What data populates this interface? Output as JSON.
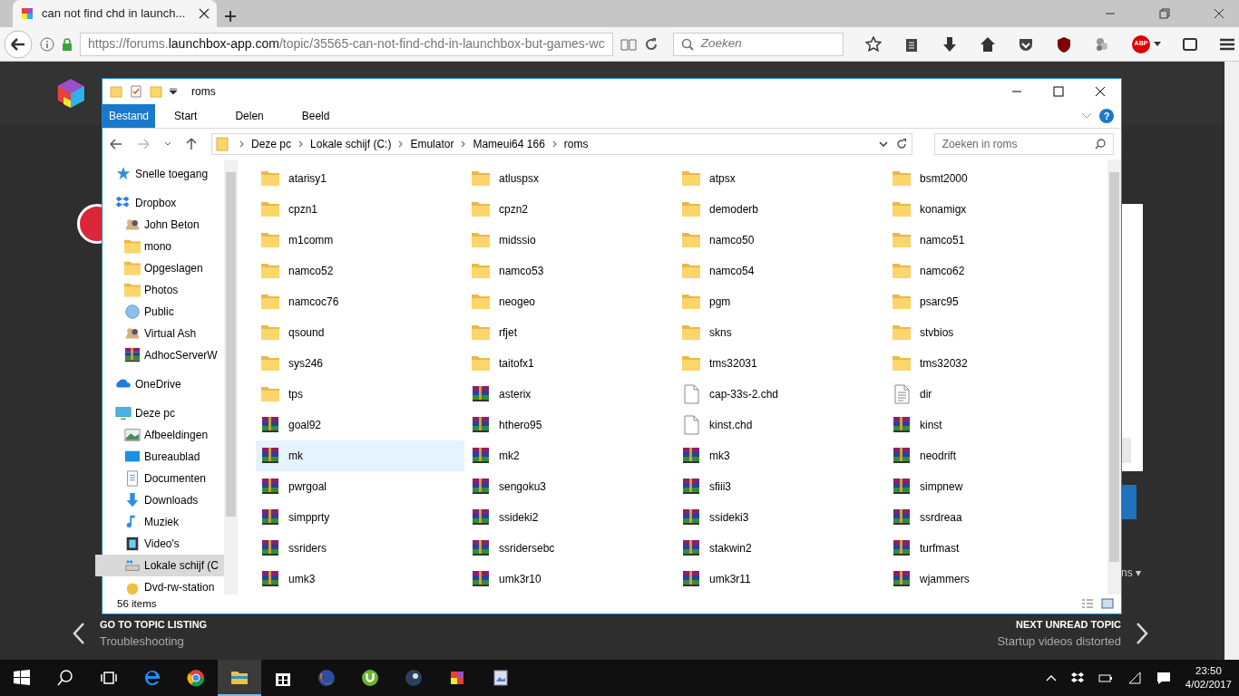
{
  "browser": {
    "tab_title": "can not find chd in launch...",
    "url_scheme": "https://forums.",
    "url_domain": "launchbox-app.com",
    "url_path": "/topic/35565-can-not-find-chd-in-launchbox-but-games-wc",
    "search_placeholder": "Zoeken",
    "abp": "ABP"
  },
  "page": {
    "prev_label": "GO TO TOPIC LISTING",
    "prev_title": "Troubleshooting",
    "next_label": "NEXT UNREAD TOPIC",
    "next_title": "Startup videos distorted",
    "side_fragment": "ns ▾"
  },
  "explorer": {
    "title": "roms",
    "ribbon_tabs": [
      {
        "label": "Bestand",
        "kind": "file"
      },
      {
        "label": "Start",
        "kind": "tab"
      },
      {
        "label": "Delen",
        "kind": "tab"
      },
      {
        "label": "Beeld",
        "kind": "tab"
      }
    ],
    "breadcrumb": [
      "Deze pc",
      "Lokale schijf (C:)",
      "Emulator",
      "Mameui64 166",
      "roms"
    ],
    "search_placeholder": "Zoeken in roms",
    "help": "?",
    "sidebar": [
      {
        "label": "Snelle toegang",
        "selected": false
      },
      {
        "label": "Dropbox",
        "selected": false,
        "children": [
          {
            "label": "John Beton",
            "selected": false
          },
          {
            "label": "mono",
            "selected": false
          },
          {
            "label": "Opgeslagen",
            "selected": false
          },
          {
            "label": "Photos",
            "selected": false
          },
          {
            "label": "Public",
            "selected": false
          },
          {
            "label": "Virtual Ash",
            "selected": false
          },
          {
            "label": "AdhocServerW",
            "selected": false
          }
        ]
      },
      {
        "label": "OneDrive",
        "selected": false
      },
      {
        "label": "Deze pc",
        "selected": false,
        "children": [
          {
            "label": "Afbeeldingen",
            "selected": false
          },
          {
            "label": "Bureaublad",
            "selected": false
          },
          {
            "label": "Documenten",
            "selected": false
          },
          {
            "label": "Downloads",
            "selected": false
          },
          {
            "label": "Muziek",
            "selected": false
          },
          {
            "label": "Video's",
            "selected": false
          },
          {
            "label": "Lokale schijf (C",
            "selected": true
          },
          {
            "label": "Dvd-rw-station",
            "selected": false
          }
        ]
      }
    ],
    "files": [
      {
        "name": "atarisy1",
        "kind": "folder",
        "selected": false
      },
      {
        "name": "atluspsx",
        "kind": "folder",
        "selected": false
      },
      {
        "name": "atpsx",
        "kind": "folder",
        "selected": false
      },
      {
        "name": "bsmt2000",
        "kind": "folder",
        "selected": false
      },
      {
        "name": "cpzn1",
        "kind": "folder",
        "selected": false
      },
      {
        "name": "cpzn2",
        "kind": "folder",
        "selected": false
      },
      {
        "name": "demoderb",
        "kind": "folder",
        "selected": false
      },
      {
        "name": "konamigx",
        "kind": "folder",
        "selected": false
      },
      {
        "name": "m1comm",
        "kind": "folder",
        "selected": false
      },
      {
        "name": "midssio",
        "kind": "folder",
        "selected": false
      },
      {
        "name": "namco50",
        "kind": "folder",
        "selected": false
      },
      {
        "name": "namco51",
        "kind": "folder",
        "selected": false
      },
      {
        "name": "namco52",
        "kind": "folder",
        "selected": false
      },
      {
        "name": "namco53",
        "kind": "folder",
        "selected": false
      },
      {
        "name": "namco54",
        "kind": "folder",
        "selected": false
      },
      {
        "name": "namco62",
        "kind": "folder",
        "selected": false
      },
      {
        "name": "namcoc76",
        "kind": "folder",
        "selected": false
      },
      {
        "name": "neogeo",
        "kind": "folder",
        "selected": false
      },
      {
        "name": "pgm",
        "kind": "folder",
        "selected": false
      },
      {
        "name": "psarc95",
        "kind": "folder",
        "selected": false
      },
      {
        "name": "qsound",
        "kind": "folder",
        "selected": false
      },
      {
        "name": "rfjet",
        "kind": "folder",
        "selected": false
      },
      {
        "name": "skns",
        "kind": "folder",
        "selected": false
      },
      {
        "name": "stvbios",
        "kind": "folder",
        "selected": false
      },
      {
        "name": "sys246",
        "kind": "folder",
        "selected": false
      },
      {
        "name": "taitofx1",
        "kind": "folder",
        "selected": false
      },
      {
        "name": "tms32031",
        "kind": "folder",
        "selected": false
      },
      {
        "name": "tms32032",
        "kind": "folder",
        "selected": false
      },
      {
        "name": "tps",
        "kind": "folder",
        "selected": false
      },
      {
        "name": "asterix",
        "kind": "archive",
        "selected": false
      },
      {
        "name": "cap-33s-2.chd",
        "kind": "file",
        "selected": false
      },
      {
        "name": "dir",
        "kind": "text",
        "selected": false
      },
      {
        "name": "goal92",
        "kind": "archive",
        "selected": false
      },
      {
        "name": "hthero95",
        "kind": "archive",
        "selected": false
      },
      {
        "name": "kinst.chd",
        "kind": "file",
        "selected": false
      },
      {
        "name": "kinst",
        "kind": "archive",
        "selected": false
      },
      {
        "name": "mk",
        "kind": "archive",
        "selected": true
      },
      {
        "name": "mk2",
        "kind": "archive",
        "selected": false
      },
      {
        "name": "mk3",
        "kind": "archive",
        "selected": false
      },
      {
        "name": "neodrift",
        "kind": "archive",
        "selected": false
      },
      {
        "name": "pwrgoal",
        "kind": "archive",
        "selected": false
      },
      {
        "name": "sengoku3",
        "kind": "archive",
        "selected": false
      },
      {
        "name": "sfiii3",
        "kind": "archive",
        "selected": false
      },
      {
        "name": "simpnew",
        "kind": "archive",
        "selected": false
      },
      {
        "name": "simpprty",
        "kind": "archive",
        "selected": false
      },
      {
        "name": "ssideki2",
        "kind": "archive",
        "selected": false
      },
      {
        "name": "ssideki3",
        "kind": "archive",
        "selected": false
      },
      {
        "name": "ssrdreaa",
        "kind": "archive",
        "selected": false
      },
      {
        "name": "ssriders",
        "kind": "archive",
        "selected": false
      },
      {
        "name": "ssridersebc",
        "kind": "archive",
        "selected": false
      },
      {
        "name": "stakwin2",
        "kind": "archive",
        "selected": false
      },
      {
        "name": "turfmast",
        "kind": "archive",
        "selected": false
      },
      {
        "name": "umk3",
        "kind": "archive",
        "selected": false
      },
      {
        "name": "umk3r10",
        "kind": "archive",
        "selected": false
      },
      {
        "name": "umk3r11",
        "kind": "archive",
        "selected": false
      },
      {
        "name": "wjammers",
        "kind": "archive",
        "selected": false
      }
    ],
    "status": "56 items"
  },
  "taskbar": {
    "time": "23:50",
    "date": "4/02/2017"
  }
}
